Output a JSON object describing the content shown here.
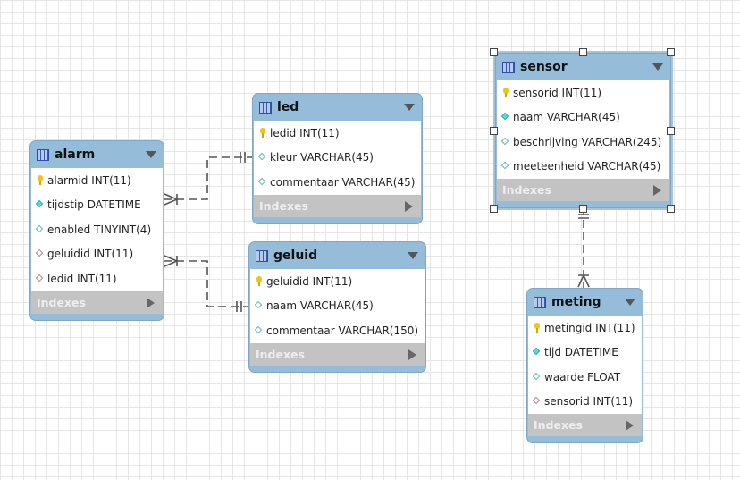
{
  "tables": {
    "alarm": {
      "name": "alarm",
      "indexes": "Indexes",
      "columns": [
        {
          "text": "alarmid INT(11)",
          "icon": "key"
        },
        {
          "text": "tijdstip DATETIME",
          "icon": "nn"
        },
        {
          "text": "enabled TINYINT(4)",
          "icon": "col"
        },
        {
          "text": "geluidid INT(11)",
          "icon": "fk"
        },
        {
          "text": "ledid INT(11)",
          "icon": "fk"
        }
      ]
    },
    "led": {
      "name": "led",
      "indexes": "Indexes",
      "columns": [
        {
          "text": "ledid INT(11)",
          "icon": "key"
        },
        {
          "text": "kleur VARCHAR(45)",
          "icon": "col"
        },
        {
          "text": "commentaar VARCHAR(45)",
          "icon": "col"
        }
      ]
    },
    "geluid": {
      "name": "geluid",
      "indexes": "Indexes",
      "columns": [
        {
          "text": "geluidid INT(11)",
          "icon": "key"
        },
        {
          "text": "naam VARCHAR(45)",
          "icon": "col"
        },
        {
          "text": "commentaar VARCHAR(150)",
          "icon": "col"
        }
      ]
    },
    "sensor": {
      "name": "sensor",
      "indexes": "Indexes",
      "columns": [
        {
          "text": "sensorid INT(11)",
          "icon": "key"
        },
        {
          "text": "naam VARCHAR(45)",
          "icon": "nn"
        },
        {
          "text": "beschrijving VARCHAR(245)",
          "icon": "col"
        },
        {
          "text": "meeteenheid VARCHAR(45)",
          "icon": "col"
        }
      ]
    },
    "meting": {
      "name": "meting",
      "indexes": "Indexes",
      "columns": [
        {
          "text": "metingid INT(11)",
          "icon": "key"
        },
        {
          "text": "tijd DATETIME",
          "icon": "nn"
        },
        {
          "text": "waarde FLOAT",
          "icon": "col"
        },
        {
          "text": "sensorid INT(11)",
          "icon": "fk"
        }
      ]
    }
  },
  "relationships": [
    {
      "from": "alarm",
      "to": "led",
      "type": "many-to-one"
    },
    {
      "from": "alarm",
      "to": "geluid",
      "type": "many-to-one"
    },
    {
      "from": "meting",
      "to": "sensor",
      "type": "many-to-one"
    }
  ],
  "selected_table": "sensor"
}
